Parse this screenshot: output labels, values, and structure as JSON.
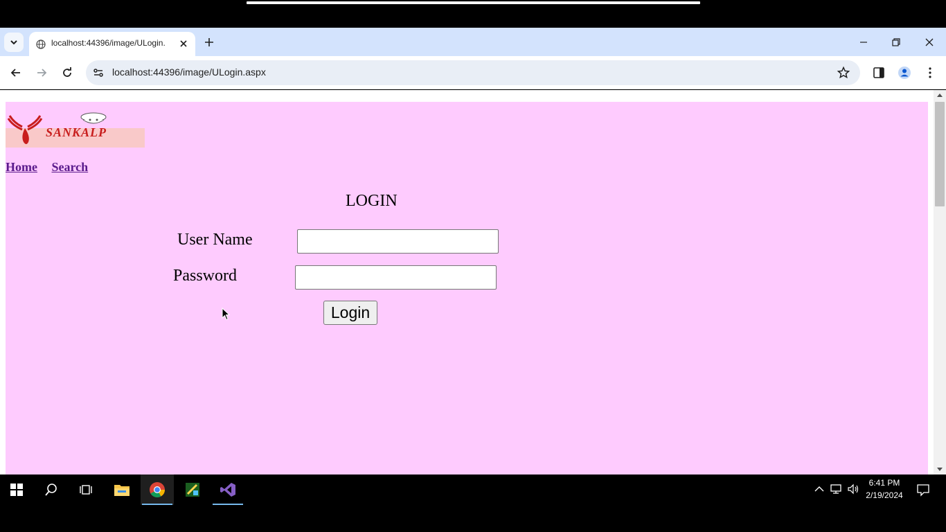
{
  "browser": {
    "tab": {
      "title": "localhost:44396/image/ULogin.",
      "favicon": "globe-icon"
    },
    "address": {
      "url": "localhost:44396/image/ULogin.aspx"
    }
  },
  "page": {
    "logo_text": "SANKALP",
    "nav": {
      "home": "Home",
      "search": "Search"
    },
    "form": {
      "title": "LOGIN",
      "username_label": "User Name",
      "username_value": "",
      "password_label": "Password",
      "password_value": "",
      "login_button": "Login"
    },
    "colors": {
      "background": "#fecbfe",
      "link": "#5a1a8c",
      "logo_red": "#c81d1d"
    }
  },
  "taskbar": {
    "apps": [
      "start-icon",
      "search-icon",
      "task-view-icon",
      "file-explorer-icon",
      "chrome-icon",
      "app-icon",
      "visual-studio-icon"
    ],
    "clock": {
      "time": "6:41 PM",
      "date": "2/19/2024"
    }
  }
}
